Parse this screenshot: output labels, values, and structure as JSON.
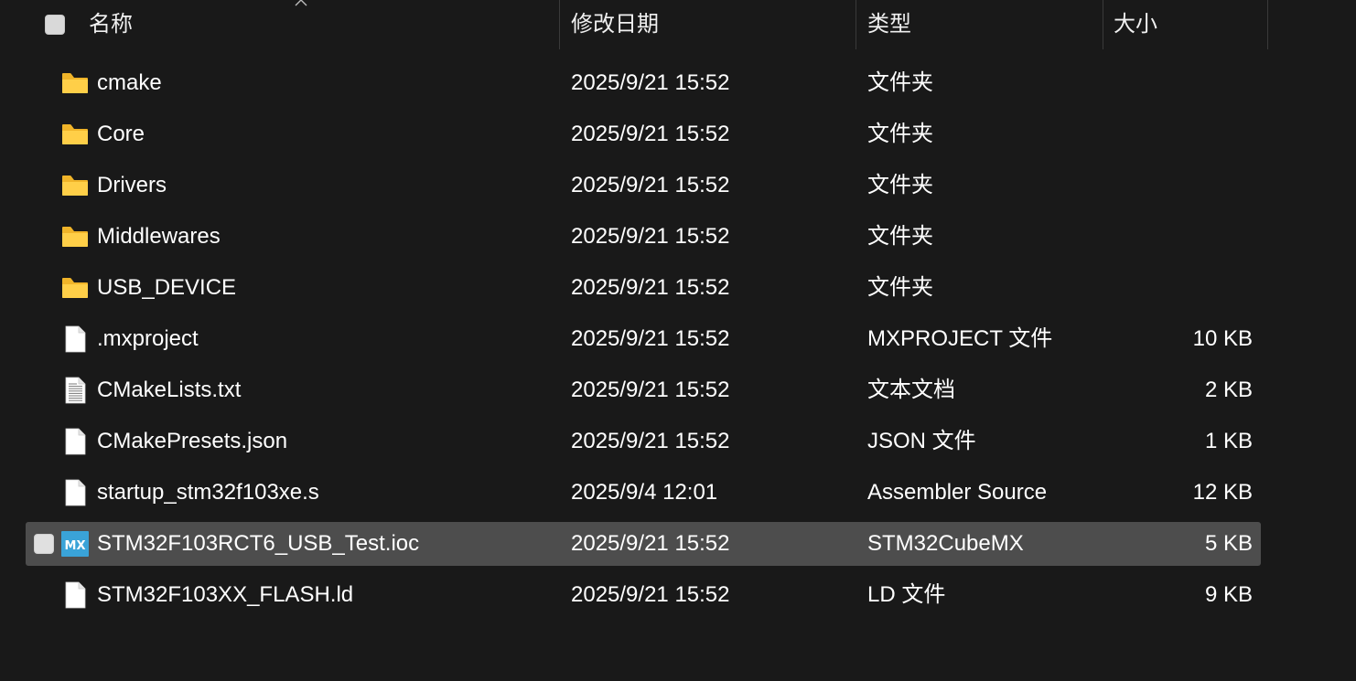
{
  "header": {
    "name": "名称",
    "modified": "修改日期",
    "type": "类型",
    "size": "大小"
  },
  "rows": [
    {
      "name": "cmake",
      "modified": "2025/9/21 15:52",
      "type": "文件夹",
      "size": "",
      "icon": "folder-icon"
    },
    {
      "name": "Core",
      "modified": "2025/9/21 15:52",
      "type": "文件夹",
      "size": "",
      "icon": "folder-icon"
    },
    {
      "name": "Drivers",
      "modified": "2025/9/21 15:52",
      "type": "文件夹",
      "size": "",
      "icon": "folder-icon"
    },
    {
      "name": "Middlewares",
      "modified": "2025/9/21 15:52",
      "type": "文件夹",
      "size": "",
      "icon": "folder-icon"
    },
    {
      "name": "USB_DEVICE",
      "modified": "2025/9/21 15:52",
      "type": "文件夹",
      "size": "",
      "icon": "folder-icon"
    },
    {
      "name": ".mxproject",
      "modified": "2025/9/21 15:52",
      "type": "MXPROJECT 文件",
      "size": "10 KB",
      "icon": "file-icon"
    },
    {
      "name": "CMakeLists.txt",
      "modified": "2025/9/21 15:52",
      "type": "文本文档",
      "size": "2 KB",
      "icon": "text-file-icon"
    },
    {
      "name": "CMakePresets.json",
      "modified": "2025/9/21 15:52",
      "type": "JSON 文件",
      "size": "1 KB",
      "icon": "file-icon"
    },
    {
      "name": "startup_stm32f103xe.s",
      "modified": "2025/9/4 12:01",
      "type": "Assembler Source",
      "size": "12 KB",
      "icon": "file-icon"
    },
    {
      "name": "STM32F103RCT6_USB_Test.ioc",
      "modified": "2025/9/21 15:52",
      "type": "STM32CubeMX",
      "size": "5 KB",
      "icon": "mx-icon",
      "icon_text": "MX",
      "selected": true
    },
    {
      "name": "STM32F103XX_FLASH.ld",
      "modified": "2025/9/21 15:52",
      "type": "LD 文件",
      "size": "9 KB",
      "icon": "file-icon"
    }
  ],
  "colors": {
    "background": "#191919",
    "selected_row": "#4d4d4d",
    "folder": "#f8c940",
    "mx_icon": "#3aa3d8"
  }
}
